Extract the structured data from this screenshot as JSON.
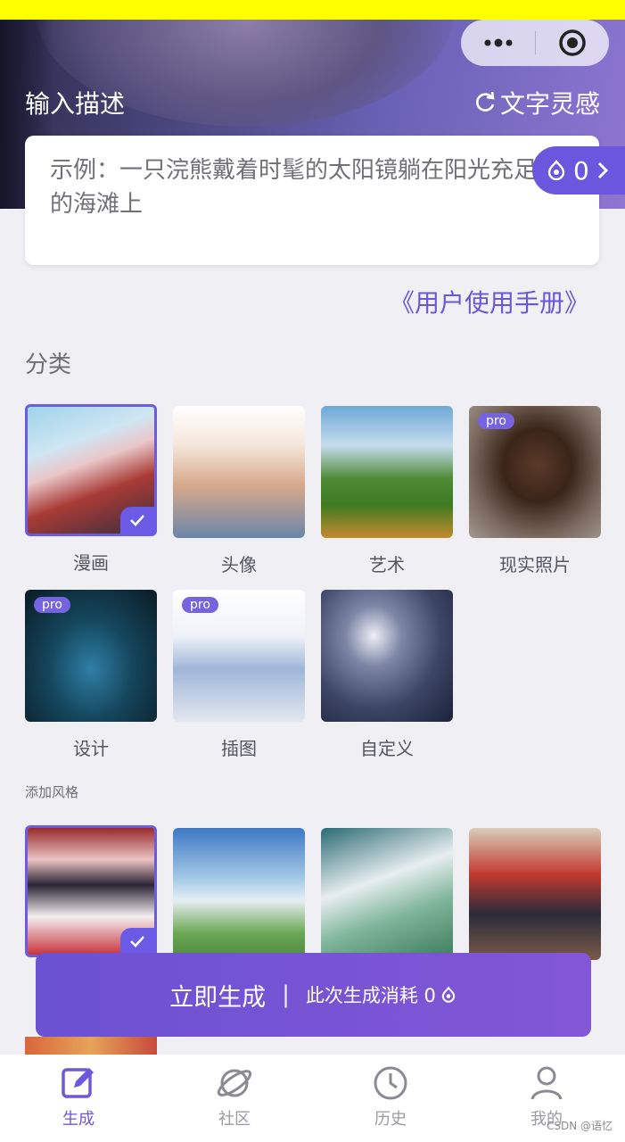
{
  "capsule": {
    "more_icon": "more-dots-icon",
    "close_icon": "target-icon"
  },
  "header": {
    "title": "输入描述",
    "inspiration": "文字灵感"
  },
  "description": {
    "placeholder": "示例：一只浣熊戴着时髦的太阳镜躺在阳光充足的海滩上"
  },
  "credits": {
    "count": "0"
  },
  "manual_link": "《用户使用手册》",
  "category": {
    "title": "分类",
    "items": [
      {
        "label": "漫画",
        "selected": true,
        "pro": false
      },
      {
        "label": "头像",
        "selected": false,
        "pro": false
      },
      {
        "label": "艺术",
        "selected": false,
        "pro": false
      },
      {
        "label": "现实照片",
        "selected": false,
        "pro": true
      },
      {
        "label": "设计",
        "selected": false,
        "pro": true
      },
      {
        "label": "插图",
        "selected": false,
        "pro": true
      },
      {
        "label": "自定义",
        "selected": false,
        "pro": false
      }
    ],
    "pro_badge": "pro"
  },
  "style": {
    "title": "添加风格"
  },
  "generate": {
    "label": "立即生成",
    "separator": "|",
    "cost": "此次生成消耗 0"
  },
  "tabbar": {
    "items": [
      {
        "label": "生成",
        "icon": "edit-icon",
        "active": true
      },
      {
        "label": "社区",
        "icon": "planet-icon",
        "active": false
      },
      {
        "label": "历史",
        "icon": "clock-icon",
        "active": false
      },
      {
        "label": "我的",
        "icon": "user-icon",
        "active": false
      }
    ]
  },
  "watermark": "CSDN @语忆",
  "colors": {
    "accent": "#6b58dd",
    "top_strip": "#ffff00",
    "background": "#efeff4"
  }
}
